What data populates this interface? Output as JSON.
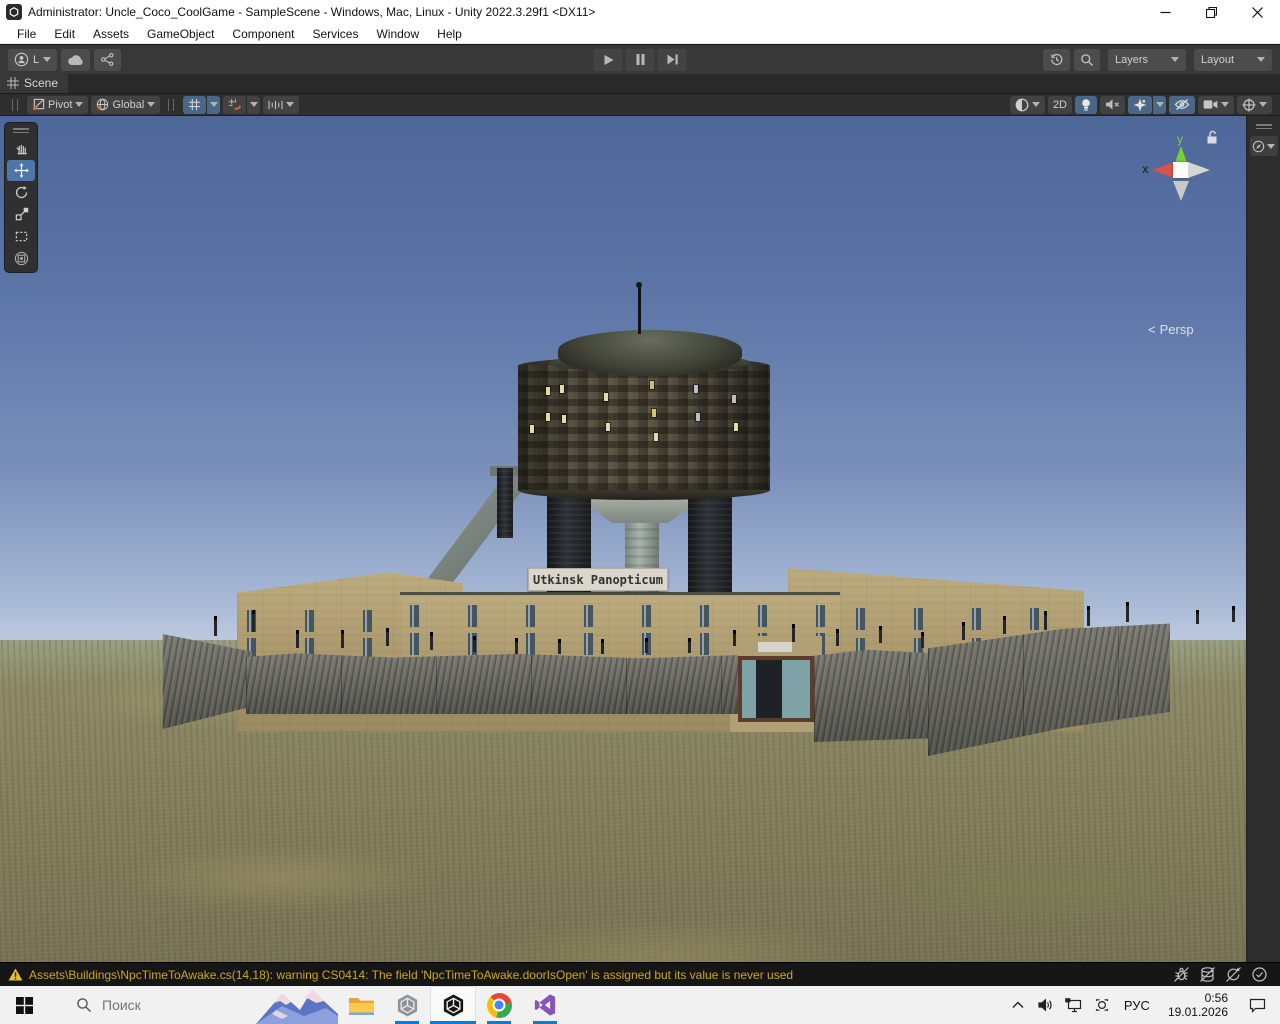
{
  "window": {
    "title": "Administrator: Uncle_Coco_CoolGame - SampleScene - Windows, Mac, Linux - Unity 2022.3.29f1 <DX11>"
  },
  "menu": {
    "items": [
      "File",
      "Edit",
      "Assets",
      "GameObject",
      "Component",
      "Services",
      "Window",
      "Help"
    ]
  },
  "toolbar": {
    "account_initial": "L",
    "layers": "Layers",
    "layout": "Layout"
  },
  "scene_tab": {
    "label": "Scene"
  },
  "scene_toolbar": {
    "pivot": "Pivot",
    "global": "Global",
    "two_d": "2D"
  },
  "viewport": {
    "gizmo": {
      "x": "x",
      "y": "y",
      "persp_prefix": "<",
      "persp": "Persp"
    },
    "sign_text": "Utkinsk Panopticum"
  },
  "status_bar": {
    "warning": "Assets\\Buildings\\NpcTimeToAwake.cs(14,18): warning CS0414: The field 'NpcTimeToAwake.doorIsOpen' is assigned but its value is never used"
  },
  "taskbar": {
    "search_placeholder": "Поиск",
    "language": "РУС",
    "time": "0:56",
    "date": "19.01.2026"
  },
  "icons": {
    "unity-logo": "dark-rounded-square-hexagon",
    "account": "person-circle",
    "cloud": "cloud",
    "collab": "share-network",
    "play": "triangle-right",
    "pause": "double-bars",
    "step": "triangle-with-bar",
    "undo-history": "clock-ccw-arrow",
    "search": "magnifier",
    "pivot": "square-with-pivot-dot",
    "global": "globe",
    "grid-visibility": "grid",
    "snap": "grid-magnet",
    "snap-increment": "ruler-ticks",
    "shading-mode": "shaded-sphere",
    "scene-lighting": "light-bulb",
    "audio-muted": "speaker-x",
    "effects": "sparkle",
    "scene-visibility": "eye-slash",
    "camera-settings": "camera",
    "gizmos": "axis-sphere",
    "view-options": "compass",
    "hand-tool": "hand",
    "move-tool": "cross-arrows",
    "rotate-tool": "circular-arrow",
    "scale-tool": "square-diagonal-arrow",
    "rect-tool": "dashed-rect",
    "transform-tool": "rect-with-circle",
    "axis-lock": "open-padlock",
    "warning": "yellow-triangle-exclamation",
    "debugger-detached": "bug-slash",
    "cache-disconnected": "database-slash",
    "refresh-paused": "refresh-slash",
    "activity-ok": "check-circle",
    "start": "windows-logo",
    "taskbar-search": "magnifier",
    "widgets": "snowy-mountains",
    "file-explorer": "yellow-folder",
    "unity-hub": "grey-hexagon",
    "unity-editor": "black-hexagon",
    "chrome": "chrome-circle",
    "visual-studio": "purple-vs-mark",
    "tray-expand": "chevron-up",
    "volume": "speaker-waves",
    "network": "monitor-plug",
    "screen-record": "record-frame",
    "action-center": "notification-bubble",
    "minimize": "minus",
    "restore": "overlapping-squares",
    "close": "x-cross"
  },
  "colors": {
    "unity_toolbar": "#383838",
    "unity_panel": "#2e2e2e",
    "toggle_highlight": "#4a6886",
    "tool_active": "#4f76a8",
    "warning_text": "#c9a727",
    "taskbar_bg": "#f1f1f1",
    "taskbar_underline": "#0b7bd6",
    "axis_x": "#d9534a",
    "axis_y": "#76d32f",
    "sky_top": "#4e679a",
    "sky_horizon": "#c0cbdf",
    "grass": "#84805e",
    "sandstone": "#bcab7e",
    "stone_wall": "#6f6f68"
  }
}
